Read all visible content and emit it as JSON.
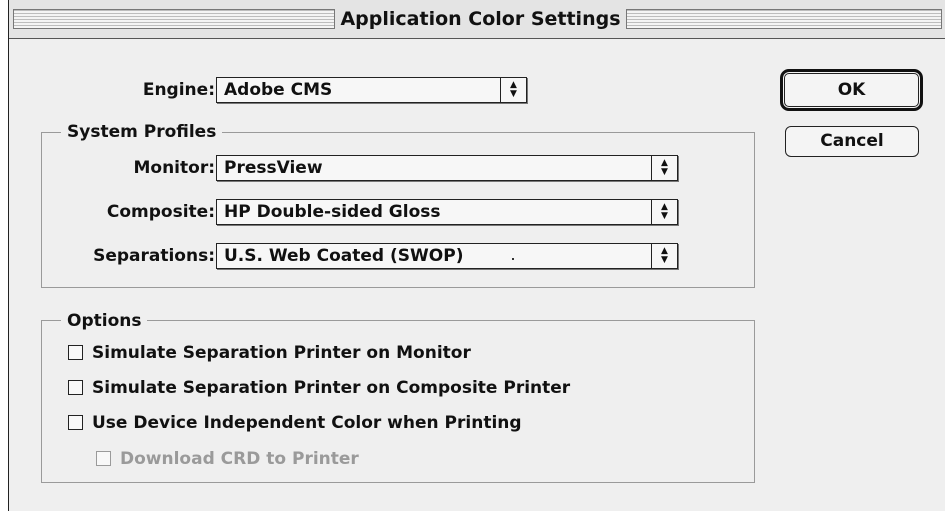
{
  "window": {
    "title": "Application Color Settings"
  },
  "engine": {
    "label": "Engine:",
    "value": "Adobe CMS"
  },
  "system_profiles": {
    "title": "System Profiles",
    "monitor": {
      "label": "Monitor:",
      "value": "PressView"
    },
    "composite": {
      "label": "Composite:",
      "value": "HP Double-sided Gloss"
    },
    "separations": {
      "label": "Separations:",
      "value": "U.S. Web Coated (SWOP)"
    }
  },
  "options": {
    "title": "Options",
    "items": [
      {
        "label": "Simulate Separation Printer on Monitor",
        "checked": false,
        "enabled": true
      },
      {
        "label": "Simulate Separation Printer on Composite Printer",
        "checked": false,
        "enabled": true
      },
      {
        "label": "Use Device Independent Color when Printing",
        "checked": false,
        "enabled": true
      },
      {
        "label": "Download CRD to Printer",
        "checked": false,
        "enabled": false
      }
    ]
  },
  "buttons": {
    "ok": "OK",
    "cancel": "Cancel"
  },
  "icons": {
    "popup_arrow": "up-down-arrows-icon"
  }
}
